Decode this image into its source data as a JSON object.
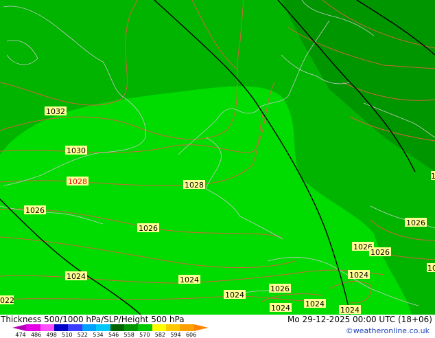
{
  "footer": {
    "title": "Thickness 500/1000 hPa/SLP/Height 500 hPa",
    "date": "Mo 29-12-2025 00:00 UTC (18+06)",
    "credit": "©weatheronline.co.uk"
  },
  "scale": {
    "ticks": [
      "474",
      "486",
      "498",
      "510",
      "522",
      "534",
      "546",
      "558",
      "570",
      "582",
      "594",
      "606"
    ],
    "colors": [
      "#b400b4",
      "#e600e6",
      "#ff50ff",
      "#0000c8",
      "#3c3cff",
      "#00a0ff",
      "#00c8ff",
      "#006400",
      "#009600",
      "#00c800",
      "#ffff00",
      "#ffc800",
      "#ffa000",
      "#ff8200"
    ]
  },
  "map": {
    "colors": {
      "dark_green": "#009600",
      "mid_green": "#00b400",
      "bright_green": "#00dc00",
      "isobar": "#d2643c",
      "coast": "#c8c8c8",
      "height_line": "#000000",
      "label_bg": "#ffff96"
    },
    "isobar_labels": [
      {
        "text": "1032",
        "color": "black"
      },
      {
        "text": "1030",
        "color": "black"
      },
      {
        "text": "1028",
        "color": "red"
      },
      {
        "text": "1028",
        "color": "black"
      },
      {
        "text": "1026",
        "color": "black"
      },
      {
        "text": "1026",
        "color": "black"
      },
      {
        "text": "1026",
        "color": "black"
      },
      {
        "text": "1026",
        "color": "black"
      },
      {
        "text": "1026",
        "color": "black"
      },
      {
        "text": "1026",
        "color": "black"
      },
      {
        "text": "1024",
        "color": "black"
      },
      {
        "text": "1024",
        "color": "black"
      },
      {
        "text": "1024",
        "color": "black"
      },
      {
        "text": "1024",
        "color": "black"
      },
      {
        "text": "1024",
        "color": "black"
      },
      {
        "text": "1024",
        "color": "black"
      },
      {
        "text": "1024",
        "color": "black"
      },
      {
        "text": "022",
        "color": "black"
      },
      {
        "text": "10",
        "color": "black"
      },
      {
        "text": "1",
        "color": "black"
      }
    ]
  }
}
